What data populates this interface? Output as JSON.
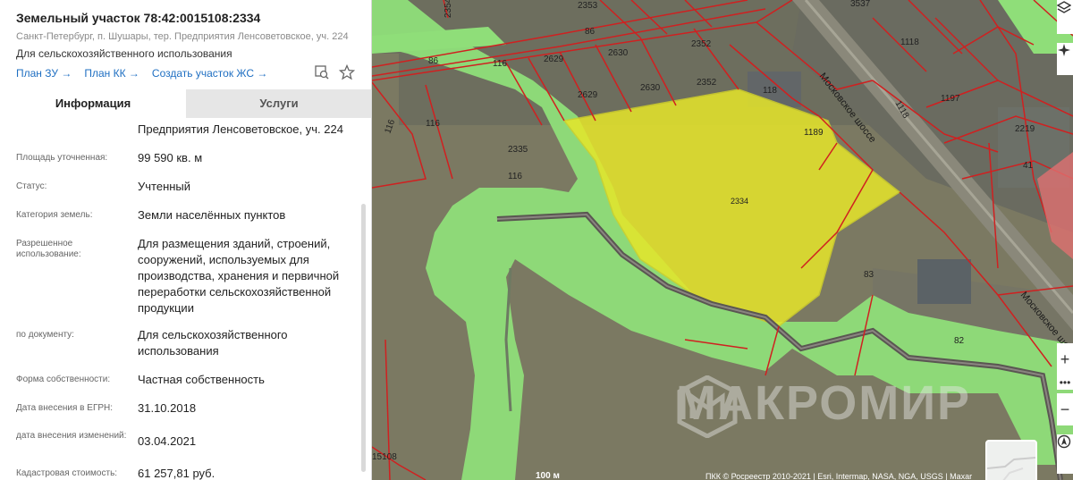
{
  "panel": {
    "title": "Земельный участок 78:42:0015108:2334",
    "address": "Санкт-Петербург, п. Шушары, тер. Предприятия Ленсоветовское, уч. 224",
    "use": "Для сельскохозяйственного использования",
    "links": [
      "План ЗУ →",
      "План КК →",
      "Создать участок ЖС →"
    ],
    "icons": [
      "search-plan-icon",
      "star-icon"
    ],
    "tabs": [
      "Информация",
      "Услуги"
    ],
    "rows": [
      {
        "label": "",
        "value": "Предприятия Ленсоветовское, уч. 224"
      },
      {
        "label": "Площадь уточненная:",
        "value": "99 590 кв. м"
      },
      {
        "label": "Статус:",
        "value": "Учтенный"
      },
      {
        "label": "Категория земель:",
        "value": "Земли населённых пунктов"
      },
      {
        "label": "Разрешенное использование:",
        "value": "Для размещения зданий, строений, сооружений, используемых для производства, хранения и первичной переработки сельскохозяйственной продукции"
      },
      {
        "label": "по документу:",
        "value": "Для сельскохозяйственного использования"
      },
      {
        "label": "Форма собственности:",
        "value": "Частная собственность"
      },
      {
        "label": "Дата внесения в ЕГРН:",
        "value": "31.10.2018"
      },
      {
        "label": "дата внесения изменений:",
        "value": "03.04.2021"
      },
      {
        "label": "Кадастровая стоимость:",
        "value": "61 257,81 руб."
      }
    ]
  },
  "map": {
    "parcel_labels": [
      "2354",
      "2353",
      "86",
      "3537",
      "2352",
      "1118",
      "86",
      "116",
      "2629",
      "2630",
      "2352",
      "118",
      "2630",
      "2629",
      "116",
      "2335",
      "1189",
      "1118",
      "1197",
      "2219",
      "116",
      "116",
      "41",
      "2334",
      "83",
      "82",
      "15108"
    ],
    "road_labels": [
      "Московское шоссе",
      "Московское шо"
    ],
    "scale": "100 м",
    "copyright": "ПКК © Росреестр 2010-2021 | Esri, Intermap, NASA, NGA, USGS | Maxar",
    "watermark": "МАКРОМИР",
    "controls": [
      "layers-icon",
      "compass-icon",
      "zoom-in-icon",
      "more-icon",
      "zoom-out-icon",
      "location-icon"
    ],
    "colors": {
      "selected_parcel": "#e8e830",
      "zone": "#8de07a",
      "boundary": "#d02020"
    }
  }
}
